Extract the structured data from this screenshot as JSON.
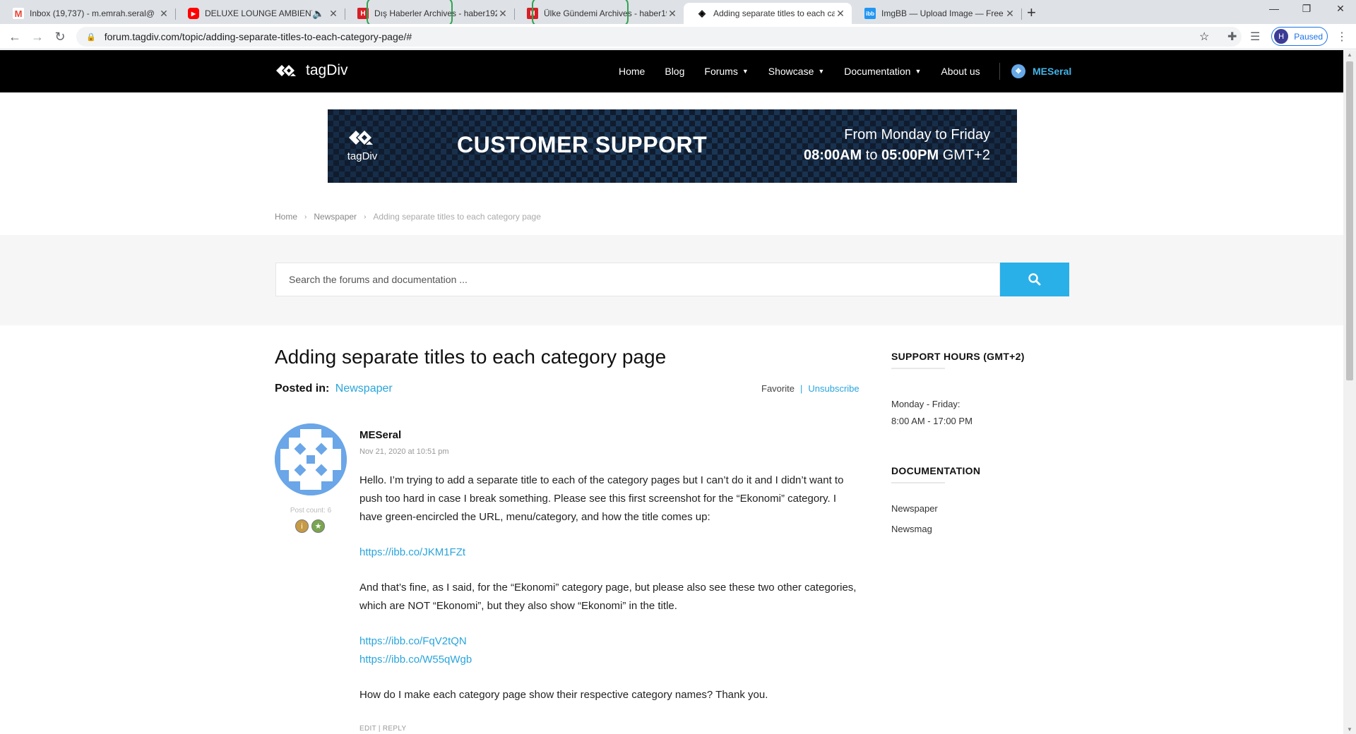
{
  "browser": {
    "tabs": [
      {
        "title": "Inbox (19,737) - m.emrah.seral@",
        "icon": "gmail-icon",
        "icon_color": "#ea4335"
      },
      {
        "title": "DELUXE LOUNGE AMBIENT H",
        "icon": "youtube-icon",
        "icon_color": "#ff0000"
      },
      {
        "title": "Dış Haberler Archives - haber192",
        "icon": "h-site-icon",
        "icon_color": "#d61f26"
      },
      {
        "title": "Ülke Gündemi Archives - haber19",
        "icon": "h-site-icon",
        "icon_color": "#d61f26"
      },
      {
        "title": "Adding separate titles to each ca",
        "icon": "tagdiv-icon",
        "icon_color": "#000000"
      },
      {
        "title": "ImgBB — Upload Image — Free I",
        "icon": "imgbb-icon",
        "icon_color": "#2196f3"
      }
    ],
    "url": "forum.tagdiv.com/topic/adding-separate-titles-to-each-category-page/#",
    "profile_initial": "H",
    "profile_status": "Paused"
  },
  "site": {
    "logo_text": "tagDiv",
    "nav": [
      "Home",
      "Blog",
      "Forums",
      "Showcase",
      "Documentation",
      "About us"
    ],
    "username": "MESeral",
    "accent_color": "#29b0e8"
  },
  "banner": {
    "logo_text": "tagDiv",
    "title": "CUSTOMER SUPPORT",
    "days": "From Monday to Friday",
    "open": "08:00AM",
    "to": "to",
    "close": "05:00PM",
    "tz": "GMT+2"
  },
  "breadcrumb": {
    "home": "Home",
    "parent": "Newspaper",
    "current": "Adding separate titles to each category page"
  },
  "search": {
    "placeholder": "Search the forums and documentation ..."
  },
  "topic": {
    "title": "Adding separate titles to each category page",
    "posted_in_label": "Posted in:",
    "category": "Newspaper",
    "favorite": "Favorite",
    "separator": "|",
    "unsubscribe": "Unsubscribe"
  },
  "post": {
    "author": "MESeral",
    "date": "Nov 21, 2020 at 10:51 pm",
    "post_count": "Post count: 6",
    "p1": "Hello. I’m trying to add a separate title to each of the category pages but I can’t do it and I didn’t want to push too hard in case I break something. Please see this first screenshot for the “Ekonomi” category. I have green-encircled the URL, menu/category, and how the title comes up:",
    "link1": "https://ibb.co/JKM1FZt",
    "p2": "And that’s fine, as I said, for the “Ekonomi” category page, but please also see these two other categories, which are NOT “Ekonomi”, but they also show “Ekonomi” in the title.",
    "link2": "https://ibb.co/FqV2tQN",
    "link3": "https://ibb.co/W55qWgb",
    "p3": "How do I make each category page show their respective category names? Thank you.",
    "edit": "EDIT",
    "reply": "REPLY"
  },
  "sidebar": {
    "support_title": "SUPPORT HOURS (GMT+2)",
    "support_days": "Monday - Friday:",
    "support_hours": "8:00 AM - 17:00 PM",
    "doc_title": "DOCUMENTATION",
    "doc_links": [
      "Newspaper",
      "Newsmag"
    ]
  }
}
